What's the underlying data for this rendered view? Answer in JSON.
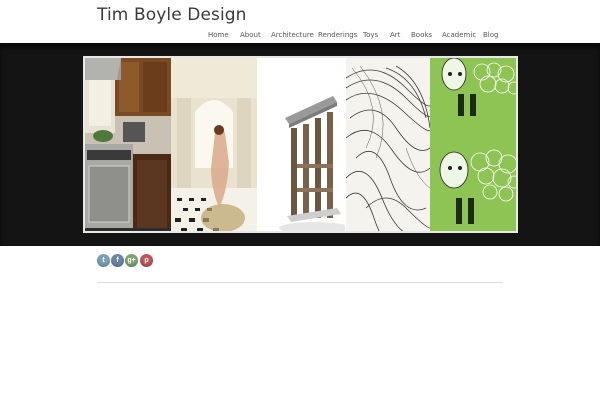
{
  "site": {
    "title": "Tim Boyle Design"
  },
  "nav": {
    "items": [
      {
        "label": "Home"
      },
      {
        "label": "About"
      },
      {
        "label": "Architecture"
      },
      {
        "label": "Renderings"
      },
      {
        "label": "Toys"
      },
      {
        "label": "Art"
      },
      {
        "label": "Books"
      },
      {
        "label": "Academic"
      },
      {
        "label": "Blog"
      }
    ]
  },
  "banner": {
    "panels": [
      {
        "subject": "kitchen interior"
      },
      {
        "subject": "hallway with figure"
      },
      {
        "subject": "architectural model"
      },
      {
        "subject": "line drawing"
      },
      {
        "subject": "sheep illustration",
        "accent": "#8ec454"
      }
    ]
  },
  "social": {
    "icons": [
      {
        "name": "twitter-icon",
        "glyph": "t",
        "color": "#7a9fb6"
      },
      {
        "name": "facebook-icon",
        "glyph": "f",
        "color": "#6b84a9"
      },
      {
        "name": "google-plus-icon",
        "glyph": "g+",
        "color": "#7ca36f"
      },
      {
        "name": "pinterest-icon",
        "glyph": "p",
        "color": "#c2545b"
      }
    ]
  }
}
